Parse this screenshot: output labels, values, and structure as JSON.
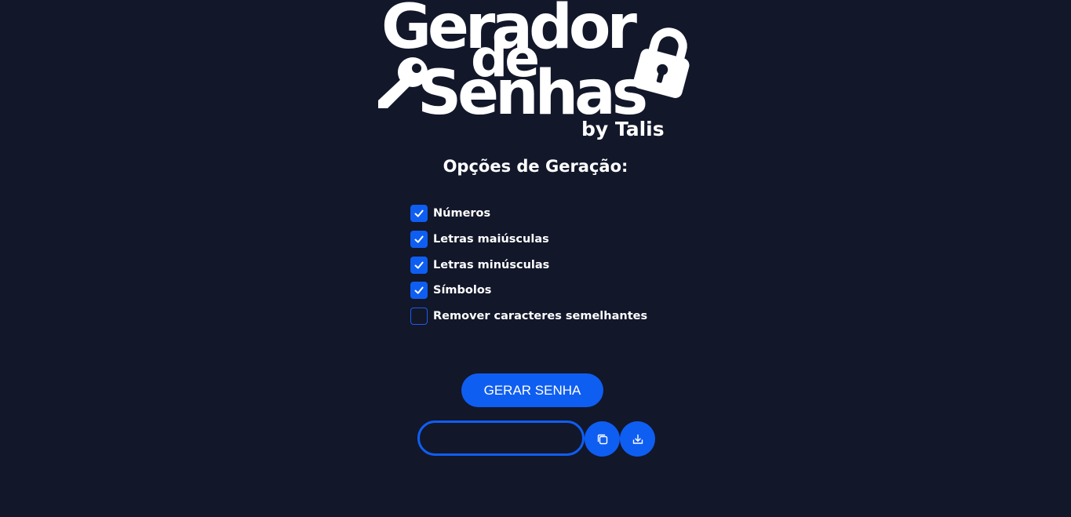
{
  "logo": {
    "line1": "Gerador",
    "line2": "de",
    "line3": "Senhas",
    "byline": "by Talis"
  },
  "options": {
    "title": "Opções de Geração:",
    "items": [
      {
        "label": "Números",
        "checked": true
      },
      {
        "label": "Letras maiúsculas",
        "checked": true
      },
      {
        "label": "Letras minúsculas",
        "checked": true
      },
      {
        "label": "Símbolos",
        "checked": true
      },
      {
        "label": "Remover caracteres semelhantes",
        "checked": false
      }
    ]
  },
  "generate": {
    "button_label": "GERAR SENHA"
  },
  "password": {
    "value": "",
    "placeholder": ""
  },
  "icons": {
    "copy": "copy-icon",
    "download": "download-icon",
    "key": "key-icon",
    "lock": "lock-icon",
    "check": "check-icon"
  },
  "colors": {
    "background": "#12172a",
    "accent": "#0f5ef2",
    "text": "#ffffff"
  }
}
